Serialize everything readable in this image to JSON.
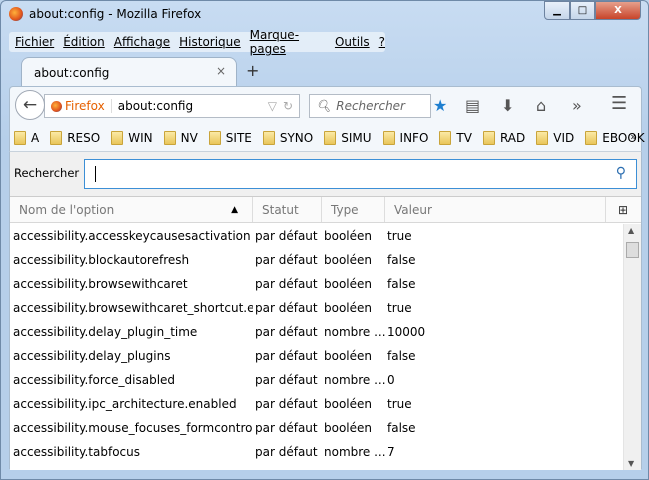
{
  "window": {
    "title": "about:config - Mozilla Firefox",
    "minimize": "▁",
    "maximize": "□",
    "close": "X"
  },
  "menu": [
    "Fichier",
    "Édition",
    "Affichage",
    "Historique",
    "Marque-pages",
    "Outils",
    "?"
  ],
  "tab": {
    "label": "about:config",
    "close": "×",
    "new": "+"
  },
  "nav": {
    "identity": "Firefox",
    "url": "about:config",
    "search_placeholder": "Rechercher"
  },
  "bookmarks": [
    "A",
    "RESO",
    "WIN",
    "NV",
    "SITE",
    "SYNO",
    "SIMU",
    "INFO",
    "TV",
    "RAD",
    "VID",
    "EBOOK"
  ],
  "bookmarks_more": "»",
  "config": {
    "search_label": "Rechercher :",
    "search_value": "",
    "columns": [
      "Nom de l'option",
      "Statut",
      "Type",
      "Valeur"
    ],
    "rows": [
      [
        "accessibility.accesskeycausesactivation",
        "par défaut",
        "booléen",
        "true"
      ],
      [
        "accessibility.blockautorefresh",
        "par défaut",
        "booléen",
        "false"
      ],
      [
        "accessibility.browsewithcaret",
        "par défaut",
        "booléen",
        "false"
      ],
      [
        "accessibility.browsewithcaret_shortcut.ena...",
        "par défaut",
        "booléen",
        "true"
      ],
      [
        "accessibility.delay_plugin_time",
        "par défaut",
        "nombre ...",
        "10000"
      ],
      [
        "accessibility.delay_plugins",
        "par défaut",
        "booléen",
        "false"
      ],
      [
        "accessibility.force_disabled",
        "par défaut",
        "nombre ...",
        "0"
      ],
      [
        "accessibility.ipc_architecture.enabled",
        "par défaut",
        "booléen",
        "true"
      ],
      [
        "accessibility.mouse_focuses_formcontrol",
        "par défaut",
        "booléen",
        "false"
      ],
      [
        "accessibility.tabfocus",
        "par défaut",
        "nombre ...",
        "7"
      ]
    ]
  }
}
